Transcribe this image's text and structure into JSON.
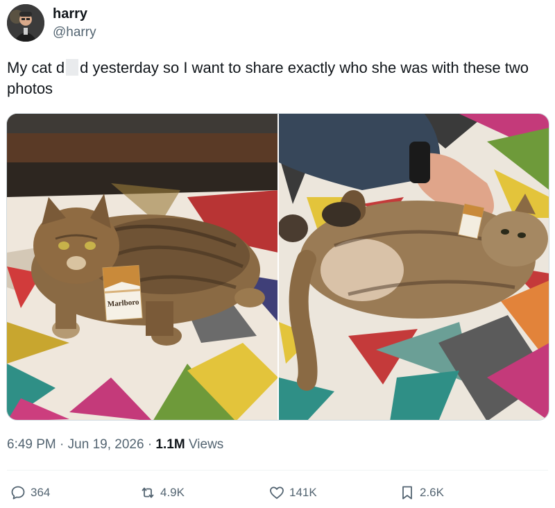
{
  "user": {
    "display_name": "harry",
    "handle": "@harry"
  },
  "tweet": {
    "text_before": "My cat d",
    "text_after": "d yesterday so I want to share exactly who she was with these two photos"
  },
  "media": {
    "left_photo": {
      "box_label": "Marlboro"
    },
    "right_photo": {}
  },
  "meta": {
    "time": "6:49 PM",
    "separator": "·",
    "date": "Jun 19, 2026",
    "views_count": "1.1M",
    "views_label": "Views"
  },
  "actions": {
    "replies": "364",
    "reposts": "4.9K",
    "likes": "141K",
    "bookmarks": "2.6K"
  },
  "icons": {
    "reply": "reply-icon",
    "repost": "repost-icon",
    "like": "heart-icon",
    "bookmark": "bookmark-icon"
  }
}
